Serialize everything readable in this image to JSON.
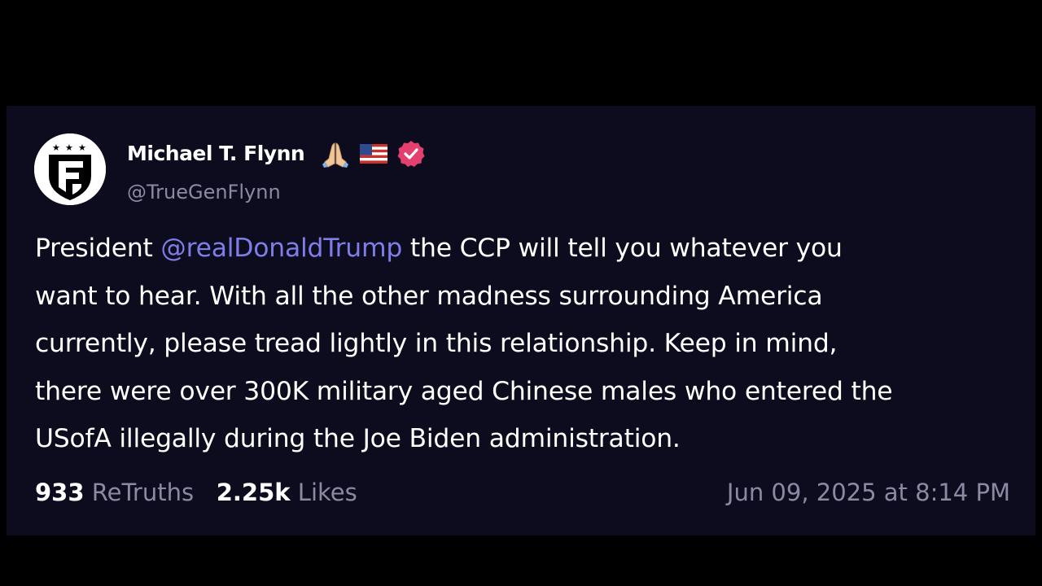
{
  "post": {
    "author_name": "Michael T. Flynn",
    "handle": "@TrueGenFlynn",
    "icons": [
      "praying-hands-icon",
      "us-flag-icon",
      "verified-badge-icon"
    ],
    "body": {
      "line1_pre": "President ",
      "mention": "@realDonaldTrump",
      "line1_post": " the CCP will tell you whatever you",
      "line2": "want to hear. With all the other madness surrounding America",
      "line3": "currently, please tread lightly in this relationship. Keep in mind,",
      "line4": "there were over 300K military aged Chinese males who entered the",
      "line5": "USofA illegally during the Joe Biden administration."
    },
    "stats": {
      "retruths_count": "933",
      "retruths_label": "ReTruths",
      "likes_count": "2.25k",
      "likes_label": "Likes"
    },
    "timestamp": "Jun 09, 2025 at 8:14 PM"
  },
  "colors": {
    "page_background": "#000000",
    "card_background": "#0d0c1e",
    "text_primary": "#ffffff",
    "text_secondary": "#8c8aa3",
    "mention": "#7f7ee8",
    "verified_badge": "#e4406f"
  }
}
